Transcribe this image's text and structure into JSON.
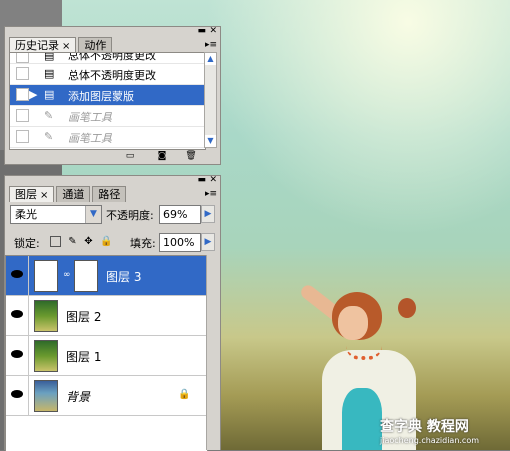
{
  "history_panel": {
    "tabs": [
      {
        "label": "历史记录",
        "close": "×"
      },
      {
        "label": "动作"
      }
    ],
    "rows": [
      {
        "label": "总体不透明度更改",
        "icon": "history-state-icon",
        "state": "partial"
      },
      {
        "label": "总体不透明度更改",
        "icon": "history-state-icon",
        "state": "normal"
      },
      {
        "label": "添加图层蒙版",
        "icon": "history-state-icon",
        "state": "selected"
      },
      {
        "label": "画笔工具",
        "icon": "brush-icon",
        "state": "dim"
      },
      {
        "label": "画笔工具",
        "icon": "brush-icon",
        "state": "dim"
      },
      {
        "label": "画笔工具",
        "icon": "brush-icon",
        "state": "dim-partial"
      }
    ],
    "toolbar_icons": [
      "new-document-from-state-icon",
      "snapshot-camera-icon",
      "trash-icon"
    ]
  },
  "layers_panel": {
    "tabs": [
      {
        "label": "图层",
        "close": "×"
      },
      {
        "label": "通道"
      },
      {
        "label": "路径"
      }
    ],
    "blend_mode": "柔光",
    "opacity_label": "不透明度:",
    "opacity_value": "69%",
    "lock_label": "锁定:",
    "fill_label": "填充:",
    "fill_value": "100%",
    "lock_icons": [
      "lock-transparent-icon",
      "lock-brush-icon",
      "lock-move-icon",
      "lock-all-icon"
    ],
    "layers": [
      {
        "name": "图层 3",
        "visible": true,
        "selected": true,
        "has_mask": true,
        "thumb": "white"
      },
      {
        "name": "图层 2",
        "visible": true,
        "selected": false,
        "has_mask": false,
        "thumb": "photo"
      },
      {
        "name": "图层 1",
        "visible": true,
        "selected": false,
        "has_mask": false,
        "thumb": "photo"
      },
      {
        "name": "背景",
        "visible": true,
        "selected": false,
        "has_mask": false,
        "thumb": "photo2",
        "locked": true,
        "italic": true
      }
    ]
  },
  "watermark": {
    "main": "查字典 教程网",
    "sub": "jiaocheng.chazidian.com"
  },
  "colors": {
    "selection": "#3169c6",
    "panel": "#d6d3ce"
  }
}
